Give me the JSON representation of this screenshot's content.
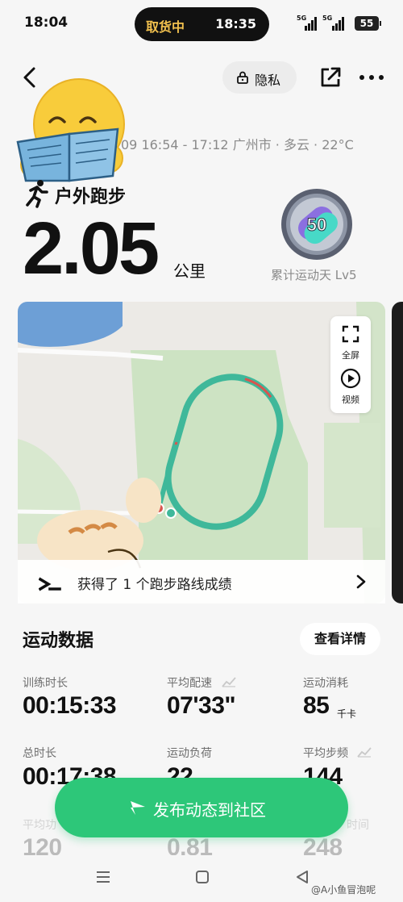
{
  "status_bar": {
    "time": "18:04",
    "pill_label": "取货中",
    "pill_time": "18:35",
    "signal_1": "5G",
    "signal_2": "5G",
    "battery": "55"
  },
  "header": {
    "privacy_label": "隐私",
    "meta_line": "09 16:54 - 17:12 广州市 · 多云 · 22°C"
  },
  "activity": {
    "type": "户外跑步",
    "distance": "2.05",
    "unit": "公里",
    "badge_number": "50",
    "badge_label": "累计运动天 Lv5"
  },
  "map": {
    "fullscreen_label": "全屏",
    "video_label": "视频",
    "route_text": "获得了 1 个跑步路线成绩",
    "route_color": "#3fb89a",
    "route_highlight": "#d9544f"
  },
  "data_section": {
    "title": "运动数据",
    "detail_button": "查看详情",
    "stats": [
      {
        "label": "训练时长",
        "value": "00:15:33",
        "unit": ""
      },
      {
        "label": "平均配速",
        "value": "07'33\"",
        "unit": ""
      },
      {
        "label": "运动消耗",
        "value": "85",
        "unit": "千卡"
      },
      {
        "label": "总时长",
        "value": "00:17:38",
        "unit": ""
      },
      {
        "label": "运动负荷",
        "value": "22",
        "unit": ""
      },
      {
        "label": "平均步频",
        "value": "144",
        "unit": ""
      },
      {
        "label": "平均功",
        "value": "120",
        "unit": ""
      },
      {
        "label": "",
        "value": "0.81",
        "unit": ""
      },
      {
        "label": "时间",
        "value": "248",
        "unit": ""
      }
    ]
  },
  "publish": {
    "label": "发布动态到社区",
    "color": "#2dc779"
  },
  "watermark": "@A小鱼冒泡呢"
}
